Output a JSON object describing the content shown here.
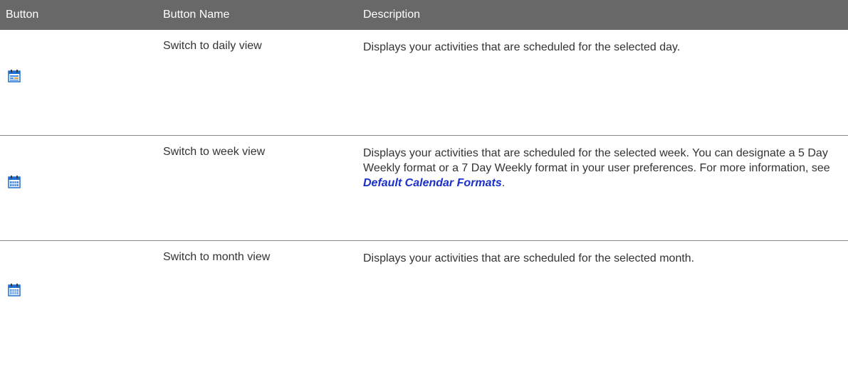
{
  "header": {
    "col_button": "Button",
    "col_button_name": "Button Name",
    "col_description": "Description"
  },
  "colors": {
    "header_bg": "#686868",
    "link": "#1b30c8",
    "icon_blue": "#1f6fd0"
  },
  "rows": [
    {
      "icon": "calendar-daily-icon",
      "name": "Switch to daily view",
      "description": "Displays your activities that are scheduled for the selected day."
    },
    {
      "icon": "calendar-week-icon",
      "name": "Switch to week view",
      "description_before": "Displays your activities that are scheduled for the selected week. You can designate a 5 Day Weekly format or a 7 Day Weekly format in your user preferences. For more information, see ",
      "link_text": "Default Calendar Formats",
      "description_after": "."
    },
    {
      "icon": "calendar-month-icon",
      "name": "Switch to month view",
      "description": "Displays your activities that are scheduled for the selected month."
    }
  ]
}
